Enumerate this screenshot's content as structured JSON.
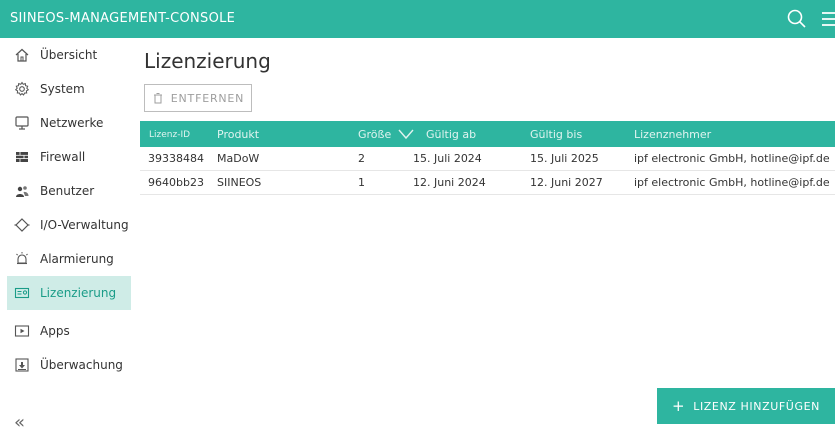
{
  "app": {
    "title": "SIINEOS-MANAGEMENT-CONSOLE"
  },
  "sidebar": {
    "items": [
      {
        "label": "Übersicht",
        "icon": "home-icon"
      },
      {
        "label": "System",
        "icon": "gear-icon"
      },
      {
        "label": "Netzwerke",
        "icon": "monitor-icon"
      },
      {
        "label": "Firewall",
        "icon": "firewall-icon"
      },
      {
        "label": "Benutzer",
        "icon": "users-icon"
      },
      {
        "label": "I/O-Verwaltung",
        "icon": "io-icon"
      },
      {
        "label": "Alarmierung",
        "icon": "alarm-icon"
      },
      {
        "label": "Lizenzierung",
        "icon": "license-icon",
        "active": true
      },
      {
        "label": "Apps",
        "icon": "apps-icon"
      },
      {
        "label": "Überwachung",
        "icon": "monitoring-icon"
      }
    ],
    "collapse_label": "«"
  },
  "page": {
    "title": "Lizenzierung",
    "remove_label": "ENTFERNEN",
    "add_label": "LIZENZ HINZUFÜGEN",
    "add_symbol": "+"
  },
  "table": {
    "headers": [
      "Lizenz-ID",
      "Produkt",
      "Größe",
      "Gültig ab",
      "Gültig bis",
      "Lizenznehmer"
    ],
    "rows": [
      [
        "39338484",
        "MaDoW",
        "2",
        "15. Juli 2024",
        "15. Juli 2025",
        "ipf electronic GmbH, hotline@ipf.de"
      ],
      [
        "9640bb23",
        "SIINEOS",
        "1",
        "12. Juni 2024",
        "12. Juni 2027",
        "ipf electronic GmbH, hotline@ipf.de"
      ]
    ]
  },
  "colors": {
    "accent": "#2eb5a0",
    "active_bg": "#cfece7",
    "active_text": "#1a9c88"
  }
}
